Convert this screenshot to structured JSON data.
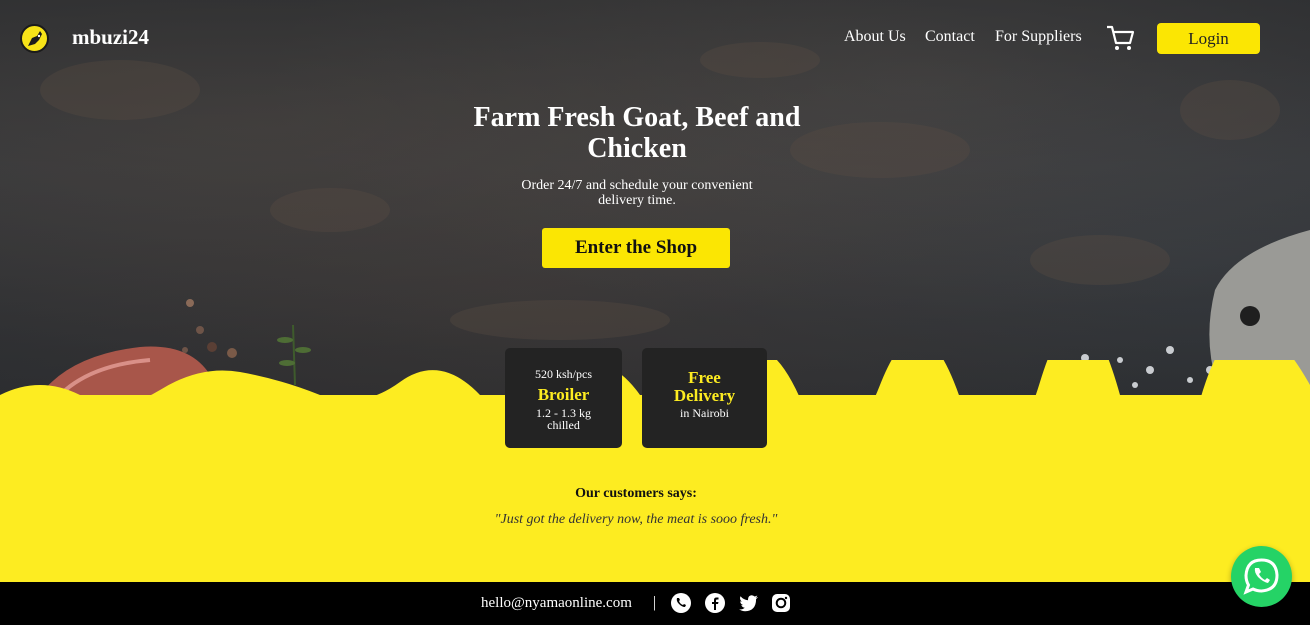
{
  "nav": {
    "brand": "mbuzi24",
    "links": [
      "About Us",
      "Contact",
      "For Suppliers"
    ],
    "cart_icon": "shopping-cart-icon",
    "login_label": "Login"
  },
  "hero": {
    "title": "Farm Fresh Goat, Beef and Chicken",
    "subtitle": "Order 24/7 and schedule your convenient delivery time.",
    "cta_label": "Enter the Shop"
  },
  "cards": [
    {
      "top": "520 ksh/pcs",
      "title": "Broiler",
      "line1": "1.2 - 1.3 kg",
      "line2": "chilled"
    },
    {
      "title1": "Free",
      "title2": "Delivery",
      "line1": "in Nairobi"
    }
  ],
  "testimonial": {
    "heading": "Our customers says:",
    "quote": "\"Just got the delivery now, the meat is sooo fresh.\""
  },
  "footer": {
    "email": "hello@nyamaonline.com",
    "separator": "|",
    "icons": [
      "whatsapp-icon",
      "facebook-icon",
      "twitter-icon",
      "instagram-icon"
    ]
  },
  "colors": {
    "accent": "#fdec21",
    "button": "#fbe603",
    "card": "#232323",
    "whatsapp": "#25d366",
    "footer": "#000000"
  }
}
